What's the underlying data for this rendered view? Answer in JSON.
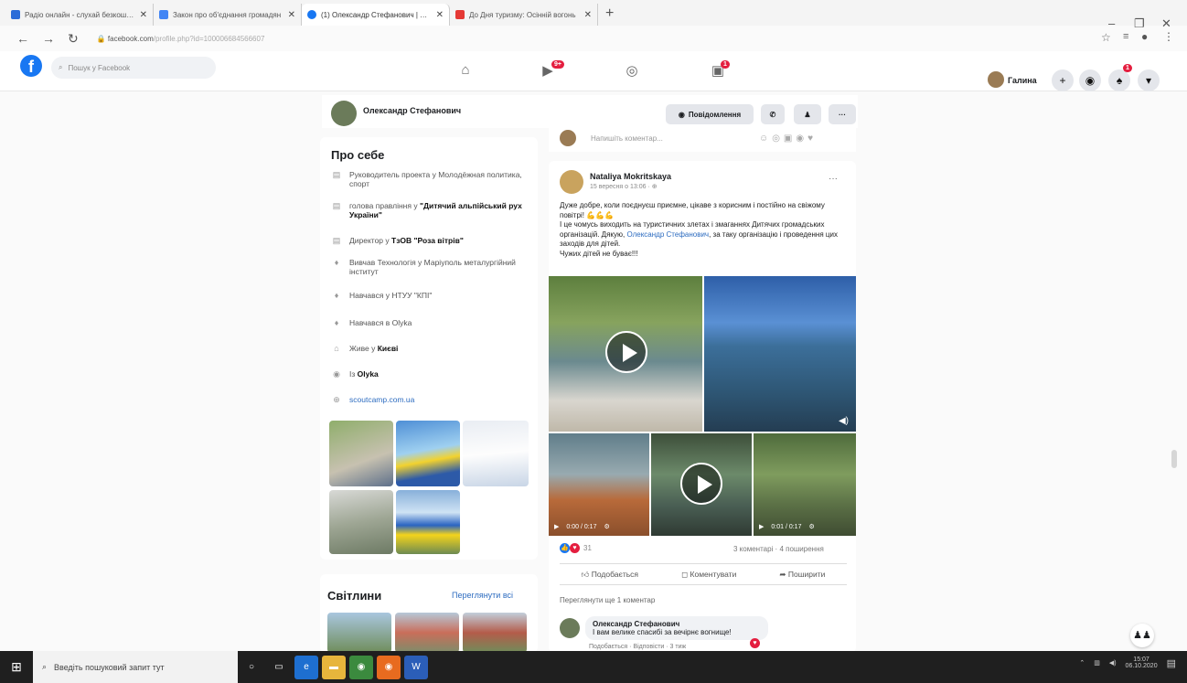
{
  "browser": {
    "tabs": [
      {
        "title": "Радіо онлайн - слухай безкоштовно",
        "favicon_color": "#2b6cd8",
        "active": false
      },
      {
        "title": "Закон про об'єднання громадян",
        "favicon_color": "#4285f4",
        "active": false
      },
      {
        "title": "(1) Олександр Стефанович | Facebook",
        "favicon_color": "#1877f2",
        "active": true
      },
      {
        "title": "До Дня туризму: Осінній вогонь",
        "favicon_color": "#e53935",
        "active": false
      }
    ],
    "url_host": "facebook.com",
    "url_path": "/profile.php?id=100006684566607"
  },
  "fb": {
    "search_placeholder": "Пошук у Facebook",
    "notif_watch": "9+",
    "notif_groups": "1",
    "notif_bell": "1",
    "user_name": "Галина"
  },
  "profile": {
    "name": "Олександр Стефанович",
    "message_label": "Повідомлення"
  },
  "about": {
    "title": "Про себе",
    "items": [
      {
        "icon": "briefcase-icon",
        "prefix": "Руководитель проекта у ",
        "bold": "",
        "text": "Молодёжная политика, спорт"
      },
      {
        "icon": "briefcase-icon",
        "prefix": "голова правління у ",
        "bold": "\"Дитячий альпійський рух України\"",
        "text": ""
      },
      {
        "icon": "briefcase-icon",
        "prefix": "Директор у ",
        "bold": "ТзОВ \"Роза вітрів\"",
        "text": ""
      },
      {
        "icon": "graduation-cap-icon",
        "prefix": "Вивчав Технологія у ",
        "bold": "",
        "text": "Маріуполь металургійний інститут"
      },
      {
        "icon": "graduation-cap-icon",
        "prefix": "Навчався у ",
        "bold": "",
        "text": "НТУУ \"КПІ\""
      },
      {
        "icon": "graduation-cap-icon",
        "prefix": "Навчався в ",
        "bold": "",
        "text": "Olyka"
      },
      {
        "icon": "home-icon",
        "prefix": "Живе у ",
        "bold": "Києві",
        "text": ""
      },
      {
        "icon": "location-pin-icon",
        "prefix": "Із ",
        "bold": "Olyka",
        "text": ""
      },
      {
        "icon": "globe-icon",
        "prefix": "",
        "bold": "",
        "text": "scoutcamp.com.ua"
      }
    ]
  },
  "photos": {
    "title": "Світлини",
    "see_all": "Переглянути всі"
  },
  "comment_bar": {
    "placeholder": "Напишіть коментар..."
  },
  "post": {
    "author": "Nataliya Mokritskaya",
    "time": "15 вересня о 13:06 · ",
    "line1": "Дуже добре, коли поєднуєш приємне, цікаве з корисним і постійно на свіжому повітрі! 💪💪💪",
    "line2": "І це чомусь виходить на туристичних злетах і змаганнях Дитячих громадських організацій. Дякую, ",
    "mention": "Олександр Стефанович",
    "line3": ", за таку організацію і проведення цих заходів для дітей.",
    "line4": "Чужих дітей не буває!!!",
    "video1_time": "0:00 / 0:17",
    "video2_time": "0:01 / 0:17",
    "reactions_count": "31",
    "comments_shares": "3 коментарі · 4 поширення",
    "like_label": "Подобається",
    "comment_label": "Коментувати",
    "share_label": "Поширити",
    "more_comments": "Переглянути ще 1 коментар",
    "comment_author": "Олександр Стефанович",
    "comment_text": "І вам велике спасибі за вечірнє вогнище!",
    "comment_meta": "Подобається · Відповісти · 3 тиж"
  },
  "taskbar": {
    "search_placeholder": "Введіть пошуковий запит тут",
    "time": "15:07",
    "date": "06.10.2020"
  }
}
